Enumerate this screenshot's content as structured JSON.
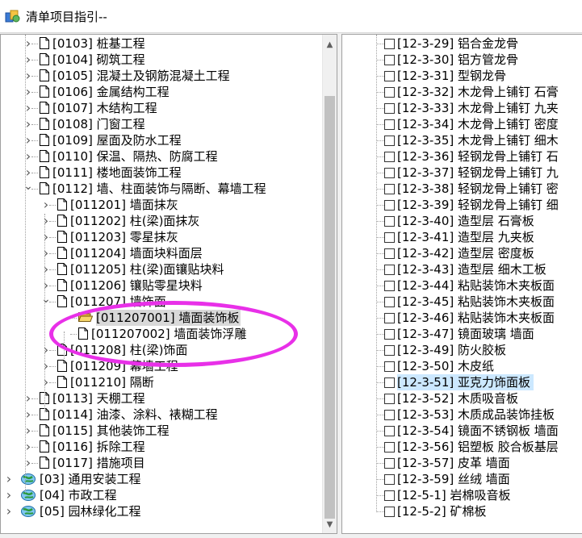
{
  "window": {
    "title": "清单项目指引--"
  },
  "left_tree": [
    {
      "label": "[0103] 桩基工程",
      "level": 1,
      "expand": "collapsed",
      "icon": "doc"
    },
    {
      "label": "[0104] 砌筑工程",
      "level": 1,
      "expand": "collapsed",
      "icon": "doc"
    },
    {
      "label": "[0105] 混凝土及钢筋混凝土工程",
      "level": 1,
      "expand": "collapsed",
      "icon": "doc"
    },
    {
      "label": "[0106] 金属结构工程",
      "level": 1,
      "expand": "collapsed",
      "icon": "doc"
    },
    {
      "label": "[0107] 木结构工程",
      "level": 1,
      "expand": "collapsed",
      "icon": "doc"
    },
    {
      "label": "[0108] 门窗工程",
      "level": 1,
      "expand": "collapsed",
      "icon": "doc"
    },
    {
      "label": "[0109] 屋面及防水工程",
      "level": 1,
      "expand": "collapsed",
      "icon": "doc"
    },
    {
      "label": "[0110] 保温、隔热、防腐工程",
      "level": 1,
      "expand": "collapsed",
      "icon": "doc"
    },
    {
      "label": "[0111] 楼地面装饰工程",
      "level": 1,
      "expand": "collapsed",
      "icon": "doc"
    },
    {
      "label": "[0112] 墙、柱面装饰与隔断、幕墙工程",
      "level": 1,
      "expand": "expanded",
      "icon": "doc"
    },
    {
      "label": "[011201] 墙面抹灰",
      "level": 2,
      "expand": "collapsed",
      "icon": "doc"
    },
    {
      "label": "[011202] 柱(梁)面抹灰",
      "level": 2,
      "expand": "collapsed",
      "icon": "doc"
    },
    {
      "label": "[011203] 零星抹灰",
      "level": 2,
      "expand": "collapsed",
      "icon": "doc"
    },
    {
      "label": "[011204] 墙面块料面层",
      "level": 2,
      "expand": "collapsed",
      "icon": "doc"
    },
    {
      "label": "[011205] 柱(梁)面镶贴块料",
      "level": 2,
      "expand": "collapsed",
      "icon": "doc"
    },
    {
      "label": "[011206] 镶贴零星块料",
      "level": 2,
      "expand": "collapsed",
      "icon": "doc"
    },
    {
      "label": "[011207] 墙饰面",
      "level": 2,
      "expand": "expanded",
      "icon": "doc"
    },
    {
      "label": "[011207001] 墙面装饰板",
      "level": 3,
      "expand": "none",
      "icon": "folder-open",
      "selected": true
    },
    {
      "label": "[011207002] 墙面装饰浮雕",
      "level": 3,
      "expand": "none",
      "icon": "doc"
    },
    {
      "label": "[011208] 柱(梁)饰面",
      "level": 2,
      "expand": "collapsed",
      "icon": "doc"
    },
    {
      "label": "[011209] 幕墙工程",
      "level": 2,
      "expand": "collapsed",
      "icon": "doc"
    },
    {
      "label": "[011210] 隔断",
      "level": 2,
      "expand": "collapsed",
      "icon": "doc"
    },
    {
      "label": "[0113] 天棚工程",
      "level": 1,
      "expand": "collapsed",
      "icon": "doc"
    },
    {
      "label": "[0114] 油漆、涂料、裱糊工程",
      "level": 1,
      "expand": "collapsed",
      "icon": "doc"
    },
    {
      "label": "[0115] 其他装饰工程",
      "level": 1,
      "expand": "collapsed",
      "icon": "doc"
    },
    {
      "label": "[0116] 拆除工程",
      "level": 1,
      "expand": "collapsed",
      "icon": "doc"
    },
    {
      "label": "[0117] 措施项目",
      "level": 1,
      "expand": "collapsed",
      "icon": "doc"
    },
    {
      "label": "[03] 通用安装工程",
      "level": 0,
      "expand": "collapsed",
      "icon": "globe"
    },
    {
      "label": "[04] 市政工程",
      "level": 0,
      "expand": "collapsed",
      "icon": "globe"
    },
    {
      "label": "[05] 园林绿化工程",
      "level": 0,
      "expand": "collapsed",
      "icon": "globe"
    }
  ],
  "right_list": [
    {
      "label": "[12-3-29] 铝合金龙骨"
    },
    {
      "label": "[12-3-30] 铝方管龙骨"
    },
    {
      "label": "[12-3-31] 型钢龙骨"
    },
    {
      "label": "[12-3-32] 木龙骨上铺钉 石膏"
    },
    {
      "label": "[12-3-33] 木龙骨上铺钉 九夹"
    },
    {
      "label": "[12-3-34] 木龙骨上铺钉 密度"
    },
    {
      "label": "[12-3-35] 木龙骨上铺钉 细木"
    },
    {
      "label": "[12-3-36] 轻钢龙骨上铺钉 石"
    },
    {
      "label": "[12-3-37] 轻钢龙骨上铺钉 九"
    },
    {
      "label": "[12-3-38] 轻钢龙骨上铺钉 密"
    },
    {
      "label": "[12-3-39] 轻钢龙骨上铺钉 细"
    },
    {
      "label": "[12-3-40] 造型层 石膏板"
    },
    {
      "label": "[12-3-41] 造型层 九夹板"
    },
    {
      "label": "[12-3-42] 造型层 密度板"
    },
    {
      "label": "[12-3-43] 造型层 细木工板"
    },
    {
      "label": "[12-3-44] 粘贴装饰木夹板面"
    },
    {
      "label": "[12-3-45] 粘贴装饰木夹板面"
    },
    {
      "label": "[12-3-46] 粘贴装饰木夹板面"
    },
    {
      "label": "[12-3-47] 镜面玻璃 墙面"
    },
    {
      "label": "[12-3-49] 防火胶板"
    },
    {
      "label": "[12-3-50] 木皮纸"
    },
    {
      "label": "[12-3-51] 亚克力饰面板",
      "highlighted": true
    },
    {
      "label": "[12-3-52] 木质吸音板"
    },
    {
      "label": "[12-3-53] 木质成品装饰挂板"
    },
    {
      "label": "[12-3-54] 镜面不锈钢板 墙面"
    },
    {
      "label": "[12-3-56] 铝塑板 胶合板基层"
    },
    {
      "label": "[12-3-57] 皮革 墙面"
    },
    {
      "label": "[12-3-59] 丝绒 墙面"
    },
    {
      "label": "[12-5-1] 岩棉吸音板"
    },
    {
      "label": "[12-5-2] 矿棉板"
    }
  ],
  "colors": {
    "selection": "#d9d9d9",
    "highlight": "#cce8ff",
    "annotation": "#e830e8"
  }
}
